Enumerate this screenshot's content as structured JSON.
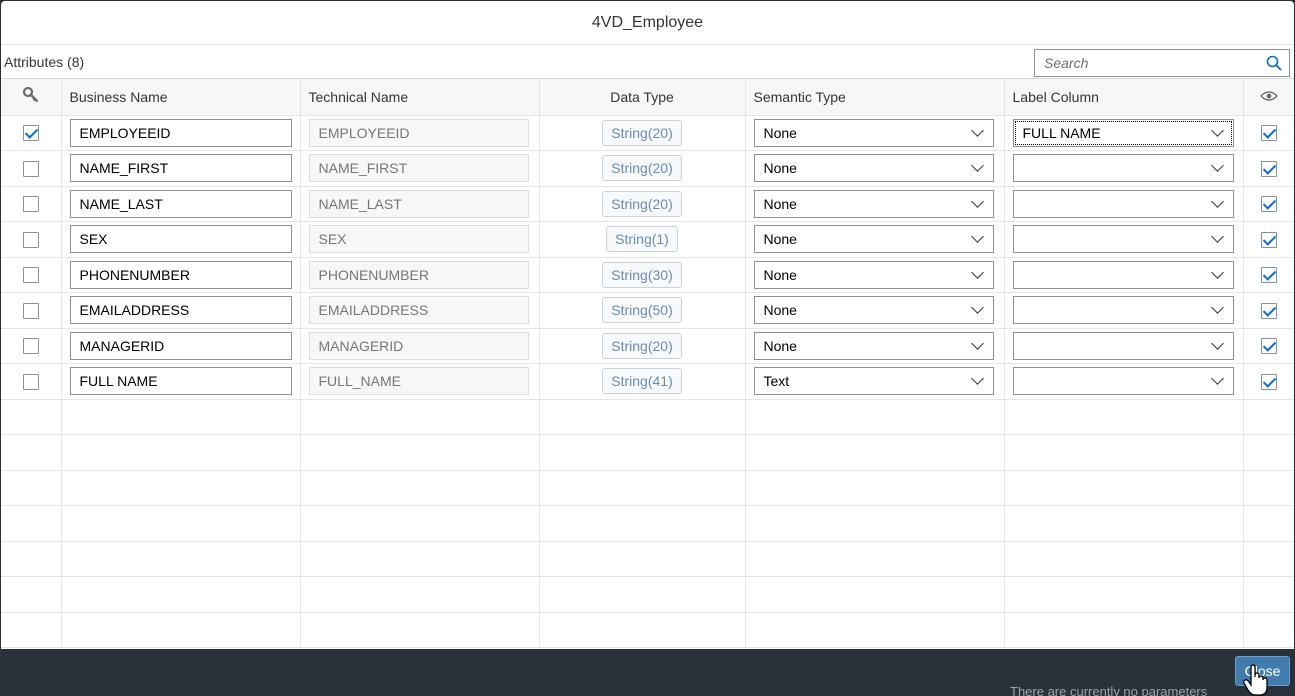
{
  "dialog": {
    "title": "4VD_Employee"
  },
  "toolbar": {
    "title": "Attributes (8)",
    "search_placeholder": "Search"
  },
  "columns": {
    "key_icon": "key-icon",
    "business_name": "Business Name",
    "technical_name": "Technical Name",
    "data_type": "Data Type",
    "semantic_type": "Semantic Type",
    "label_column": "Label Column",
    "visibility_icon": "eye-icon"
  },
  "rows": [
    {
      "key": true,
      "business_name": "EMPLOYEEID",
      "technical_name": "EMPLOYEEID",
      "data_type": "String(20)",
      "semantic_type": "None",
      "label_column": "FULL NAME",
      "visible": true
    },
    {
      "key": false,
      "business_name": "NAME_FIRST",
      "technical_name": "NAME_FIRST",
      "data_type": "String(20)",
      "semantic_type": "None",
      "label_column": "",
      "visible": true
    },
    {
      "key": false,
      "business_name": "NAME_LAST",
      "technical_name": "NAME_LAST",
      "data_type": "String(20)",
      "semantic_type": "None",
      "label_column": "",
      "visible": true
    },
    {
      "key": false,
      "business_name": "SEX",
      "technical_name": "SEX",
      "data_type": "String(1)",
      "semantic_type": "None",
      "label_column": "",
      "visible": true
    },
    {
      "key": false,
      "business_name": "PHONENUMBER",
      "technical_name": "PHONENUMBER",
      "data_type": "String(30)",
      "semantic_type": "None",
      "label_column": "",
      "visible": true
    },
    {
      "key": false,
      "business_name": "EMAILADDRESS",
      "technical_name": "EMAILADDRESS",
      "data_type": "String(50)",
      "semantic_type": "None",
      "label_column": "",
      "visible": true
    },
    {
      "key": false,
      "business_name": "MANAGERID",
      "technical_name": "MANAGERID",
      "data_type": "String(20)",
      "semantic_type": "None",
      "label_column": "",
      "visible": true
    },
    {
      "key": false,
      "business_name": "FULL NAME",
      "technical_name": "FULL_NAME",
      "data_type": "String(41)",
      "semantic_type": "Text",
      "label_column": "",
      "visible": true
    }
  ],
  "footer": {
    "close_label": "Close"
  },
  "background_text": "There are currently no parameters"
}
